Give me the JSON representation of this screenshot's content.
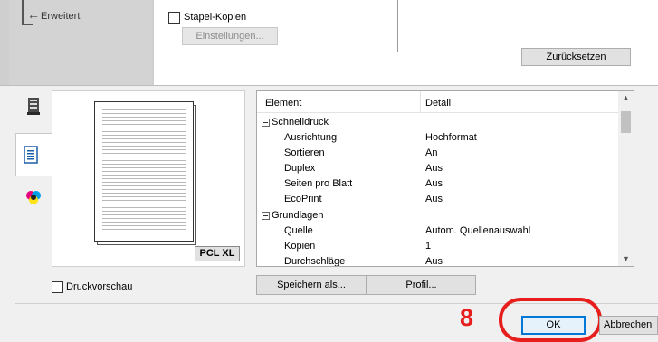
{
  "top": {
    "erweitert_label": "Erweitert",
    "stapel_kopien_label": "Stapel-Kopien",
    "einstellungen_label": "Einstellungen...",
    "zuruecksetzen_label": "Zurücksetzen"
  },
  "tabs": [
    {
      "icon": "printer-icon"
    },
    {
      "icon": "document-icon"
    },
    {
      "icon": "color-icon"
    }
  ],
  "preview": {
    "badge": "PCL XL",
    "druckvorschau_label": "Druckvorschau"
  },
  "table": {
    "headers": {
      "element": "Element",
      "detail": "Detail"
    },
    "groups": {
      "schnelldruck": "Schnelldruck",
      "grundlagen": "Grundlagen"
    },
    "rows": [
      {
        "name": "Ausrichtung",
        "value": "Hochformat"
      },
      {
        "name": "Sortieren",
        "value": "An"
      },
      {
        "name": "Duplex",
        "value": "Aus"
      },
      {
        "name": "Seiten pro Blatt",
        "value": "Aus"
      },
      {
        "name": "EcoPrint",
        "value": "Aus"
      },
      {
        "name": "Quelle",
        "value": "Autom. Quellenauswahl"
      },
      {
        "name": "Kopien",
        "value": "1"
      },
      {
        "name": "Durchschläge",
        "value": "Aus"
      }
    ]
  },
  "buttons": {
    "speichern_label": "Speichern als...",
    "profil_label": "Profil...",
    "ok_label": "OK",
    "abbrechen_label": "Abbrechen"
  },
  "annotation": {
    "step_number": "8",
    "color": "#e61e1e"
  }
}
